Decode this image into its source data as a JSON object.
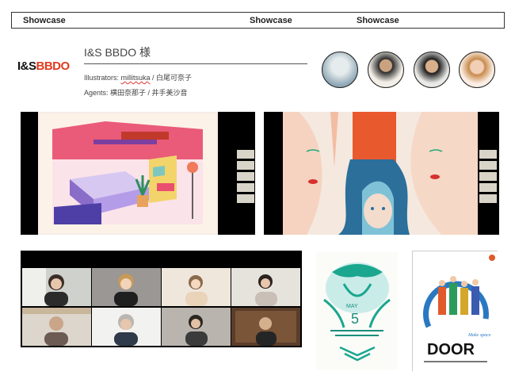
{
  "header": {
    "left_label": "Showcase",
    "center_label": "Showcase",
    "right_label": "Showcase"
  },
  "client": {
    "logo_left": "I&S",
    "logo_right": "BBDO",
    "name": "I&S BBDO 様",
    "illustrators_prefix": "Illustrators: ",
    "illustrators_link": "millitsuka",
    "illustrators_rest": " / 白尾可奈子",
    "agents": "Agents: 横田奈那子 / 井手美沙音"
  },
  "colors": {
    "brand_red": "#e03a1e",
    "frame_black": "#000000",
    "border": "#333333"
  },
  "poster_month": {
    "month": "MAY",
    "day": "5"
  },
  "poster_door": {
    "title": "DOOR",
    "tagline": "Make space"
  }
}
